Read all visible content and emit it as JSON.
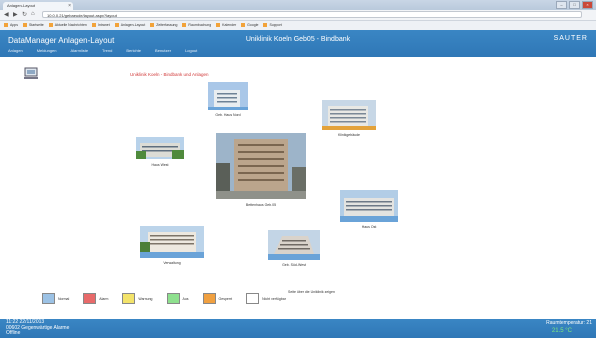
{
  "browser": {
    "tab_title": "Anlagen-Layout",
    "url": "10.0.0.21/gebaeude/layout.aspx?layout",
    "bookmarks": [
      "Apps",
      "Startseite",
      "Aktuelle Nachrichten",
      "Intranet",
      "Anlagen-Layout",
      "Zeiterfassung",
      "Raumbuchung",
      "Kalender",
      "Google",
      "Support"
    ]
  },
  "app": {
    "name": "DataManager Anlagen-Layout",
    "title": "Uniklinik Koeln Geb05 - Bindbank",
    "logo": "SAUTER",
    "nav": [
      "Anlagen",
      "Meldungen",
      "Alarmliste",
      "Trend",
      "Berichte",
      "Benutzer",
      "Logout"
    ]
  },
  "content": {
    "heading": "Uniklinik Koeln - Bindbank und Anlagen",
    "buildings": [
      {
        "label": "Geb. Haus Nord"
      },
      {
        "label": "Haus West"
      },
      {
        "label": "Klinikgebäude"
      },
      {
        "label": "Bettenhaus Geb.05"
      },
      {
        "label": "Haus Ost"
      },
      {
        "label": "Verwaltung"
      },
      {
        "label": "Geb. Süd-West"
      }
    ],
    "bottom_link": "Seite über die Uniklinik zeigen"
  },
  "legend": [
    {
      "label": "Normal",
      "color": "#9cc2e5"
    },
    {
      "label": "Alarm",
      "color": "#e86a6a"
    },
    {
      "label": "Warnung",
      "color": "#f3e36a"
    },
    {
      "label": "Aus",
      "color": "#8ee08e"
    },
    {
      "label": "Gesperrt",
      "color": "#f0a040"
    },
    {
      "label": "Nicht verfügbar",
      "color": "#ffffff"
    }
  ],
  "footer": {
    "time": "11:22 22/11/2013",
    "alarms": "00602 Gegenwärtige Alarme",
    "status": "Offline",
    "temp_label": "Raumtemperatur: 21",
    "temp_value": "21.5 °C"
  }
}
